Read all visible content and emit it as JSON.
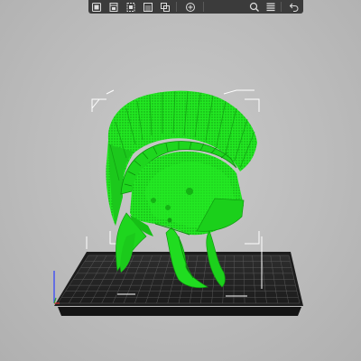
{
  "toolbar": {
    "items": [
      {
        "name": "add-model-icon"
      },
      {
        "name": "delete-icon"
      },
      {
        "name": "delete-all-icon"
      },
      {
        "name": "arrange-icon"
      },
      {
        "name": "copy-paste-icon"
      },
      {
        "name": "add-instance-icon"
      },
      {
        "name": "layers-editing-icon"
      },
      {
        "name": "zoom-icon"
      },
      {
        "name": "list-icon"
      },
      {
        "name": "undo-icon"
      }
    ]
  },
  "colors": {
    "viewport_background": "#c2c2c2",
    "model": "#22e822",
    "bed": "#262626",
    "bed_grid": "#6a6a6a",
    "toolbar": "#3b3b3b",
    "axis_z": "#2b3cff",
    "axis_x": "#d03030",
    "axis_y": "#2ea02e"
  },
  "model": {
    "name": "helmet"
  }
}
